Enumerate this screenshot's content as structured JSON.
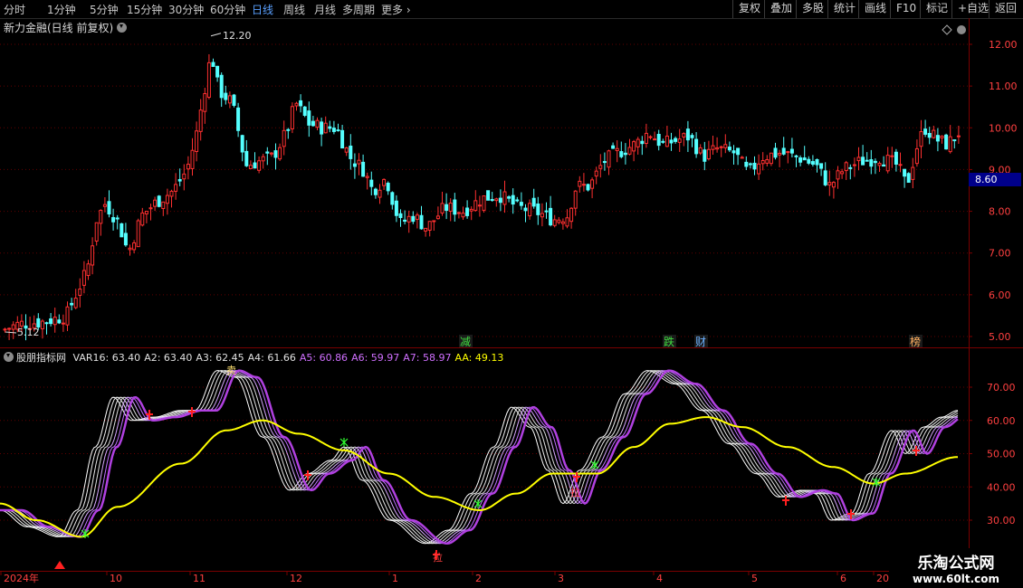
{
  "toolbar": {
    "periods": [
      {
        "label": "分时",
        "active": false
      },
      {
        "label": "1分钟",
        "active": false
      },
      {
        "label": "5分钟",
        "active": false
      },
      {
        "label": "15分钟",
        "active": false
      },
      {
        "label": "30分钟",
        "active": false
      },
      {
        "label": "60分钟",
        "active": false
      },
      {
        "label": "日线",
        "active": true
      },
      {
        "label": "周线",
        "active": false
      },
      {
        "label": "月线",
        "active": false
      },
      {
        "label": "多周期",
        "active": false
      },
      {
        "label": "更多",
        "active": false
      }
    ],
    "right_buttons": [
      "复权",
      "叠加",
      "多股",
      "统计",
      "画线",
      "F10",
      "标记",
      "+自选",
      "返回"
    ]
  },
  "main_chart": {
    "title": "新力金融(日线 前复权)",
    "high_label": "12.20",
    "low_label": "5.12",
    "current_price": "8.60",
    "price_axis": [
      "12.00",
      "11.00",
      "10.00",
      "9.00",
      "8.00",
      "7.00",
      "6.00",
      "5.00"
    ],
    "event_tags": [
      {
        "text": "减",
        "color": "#3fdc3f"
      },
      {
        "text": "跌",
        "color": "#3fdc3f"
      },
      {
        "text": "财",
        "color": "#6ab0ff"
      },
      {
        "text": "榜",
        "color": "#ffb060"
      }
    ],
    "colors": {
      "up": "#ff3030",
      "down": "#54ffff",
      "grid": "#7a0000",
      "axis_text": "#ff4040"
    }
  },
  "indicator": {
    "name": "股朋指标网",
    "values": [
      {
        "label": "VAR16: 63.40",
        "color": "#e0e0e0"
      },
      {
        "label": "A2: 63.40",
        "color": "#e0e0e0"
      },
      {
        "label": "A3: 62.45",
        "color": "#e0e0e0"
      },
      {
        "label": "A4: 61.66",
        "color": "#e0e0e0"
      },
      {
        "label": "A5: 60.86",
        "color": "#d070ff"
      },
      {
        "label": "A6: 59.97",
        "color": "#d070ff"
      },
      {
        "label": "A7: 58.97",
        "color": "#d070ff"
      },
      {
        "label": "AA: 49.13",
        "color": "#ffff00"
      }
    ],
    "axis": [
      "70.00",
      "60.00",
      "50.00",
      "40.00",
      "30.00"
    ],
    "markers": [
      "卖",
      "拉",
      "拉"
    ]
  },
  "time_axis": [
    "2024年",
    "10",
    "11",
    "12",
    "1",
    "2",
    "3",
    "4",
    "5",
    "6",
    "20"
  ],
  "watermark": {
    "line1": "乐淘公式网",
    "line2": "www.60lt.com"
  }
}
